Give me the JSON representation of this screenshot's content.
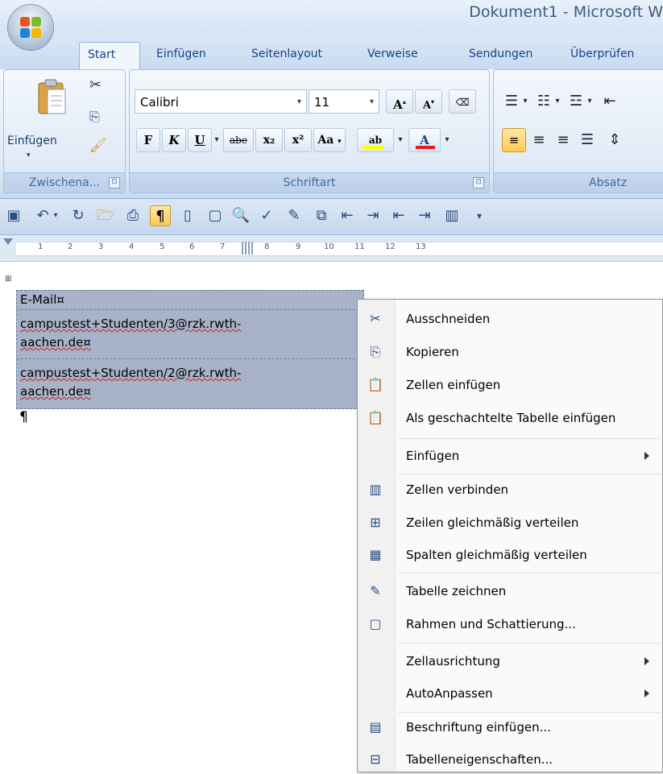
{
  "window": {
    "title": "Dokument1 - Microsoft W"
  },
  "tabs": [
    {
      "label": "Start",
      "active": true
    },
    {
      "label": "Einfügen"
    },
    {
      "label": "Seitenlayout"
    },
    {
      "label": "Verweise"
    },
    {
      "label": "Sendungen"
    },
    {
      "label": "Überprüfen"
    }
  ],
  "ribbon": {
    "clipboard": {
      "paste_label": "Einfügen",
      "group_label": "Zwischena...",
      "launcher_glyph": "⊡"
    },
    "font": {
      "font_name": "Calibri",
      "font_size": "11",
      "group_label": "Schriftart",
      "grow_label": "A",
      "shrink_label": "A",
      "bold": "F",
      "italic": "K",
      "underline": "U",
      "strike": "abe",
      "subscript": "x₂",
      "superscript": "x²",
      "case": "Aa",
      "font_color": "A",
      "highlight": "ab"
    },
    "paragraph": {
      "group_label": "Absatz"
    },
    "colors": {
      "font_color_bar": "#e31b1b",
      "highlight_bar": "#ffff00",
      "active": "#ffc65a"
    }
  },
  "ruler": {
    "numbers": [
      "1",
      "2",
      "3",
      "4",
      "5",
      "6",
      "7",
      "8",
      "9",
      "10",
      "11",
      "12",
      "13"
    ]
  },
  "document": {
    "table_cells": [
      {
        "lines": [
          "E-Mail¤"
        ]
      },
      {
        "lines": [
          "campustest+Studenten/3@rzk.rwth-",
          "aachen.de¤"
        ]
      },
      {
        "lines": [
          "campustest+Studenten/2@rzk.rwth-",
          "aachen.de¤"
        ]
      }
    ],
    "pilcrow": "¶",
    "table_handle": "⊞"
  },
  "context_menu": {
    "items": [
      {
        "label": "Ausschneiden",
        "icon": "scissors-icon",
        "glyph": "✂"
      },
      {
        "label": "Kopieren",
        "icon": "copy-icon",
        "glyph": "⎘"
      },
      {
        "label": "Zellen einfügen",
        "icon": "paste-cells-icon",
        "glyph": "📋"
      },
      {
        "label": "Als geschachtelte Tabelle einfügen",
        "icon": "paste-nested-icon",
        "glyph": "📋"
      },
      {
        "label": "Einfügen",
        "icon": "",
        "glyph": "",
        "submenu": true
      },
      {
        "label": "Zellen verbinden",
        "icon": "merge-cells-icon",
        "glyph": "▥"
      },
      {
        "label": "Zeilen gleichmäßig verteilen",
        "icon": "distribute-rows-icon",
        "glyph": "⊞"
      },
      {
        "label": "Spalten gleichmäßig verteilen",
        "icon": "distribute-columns-icon",
        "glyph": "▦"
      },
      {
        "label": "Tabelle zeichnen",
        "icon": "draw-table-icon",
        "glyph": "✎"
      },
      {
        "label": "Rahmen und Schattierung...",
        "icon": "borders-icon",
        "glyph": "▢"
      },
      {
        "label": "Zellausrichtung",
        "icon": "",
        "glyph": "",
        "submenu": true
      },
      {
        "label": "AutoAnpassen",
        "icon": "",
        "glyph": "",
        "submenu": true
      },
      {
        "label": "Beschriftung einfügen...",
        "icon": "caption-icon",
        "glyph": "▤"
      },
      {
        "label": "Tabelleneigenschaften...",
        "icon": "table-properties-icon",
        "glyph": "⊟"
      }
    ]
  }
}
